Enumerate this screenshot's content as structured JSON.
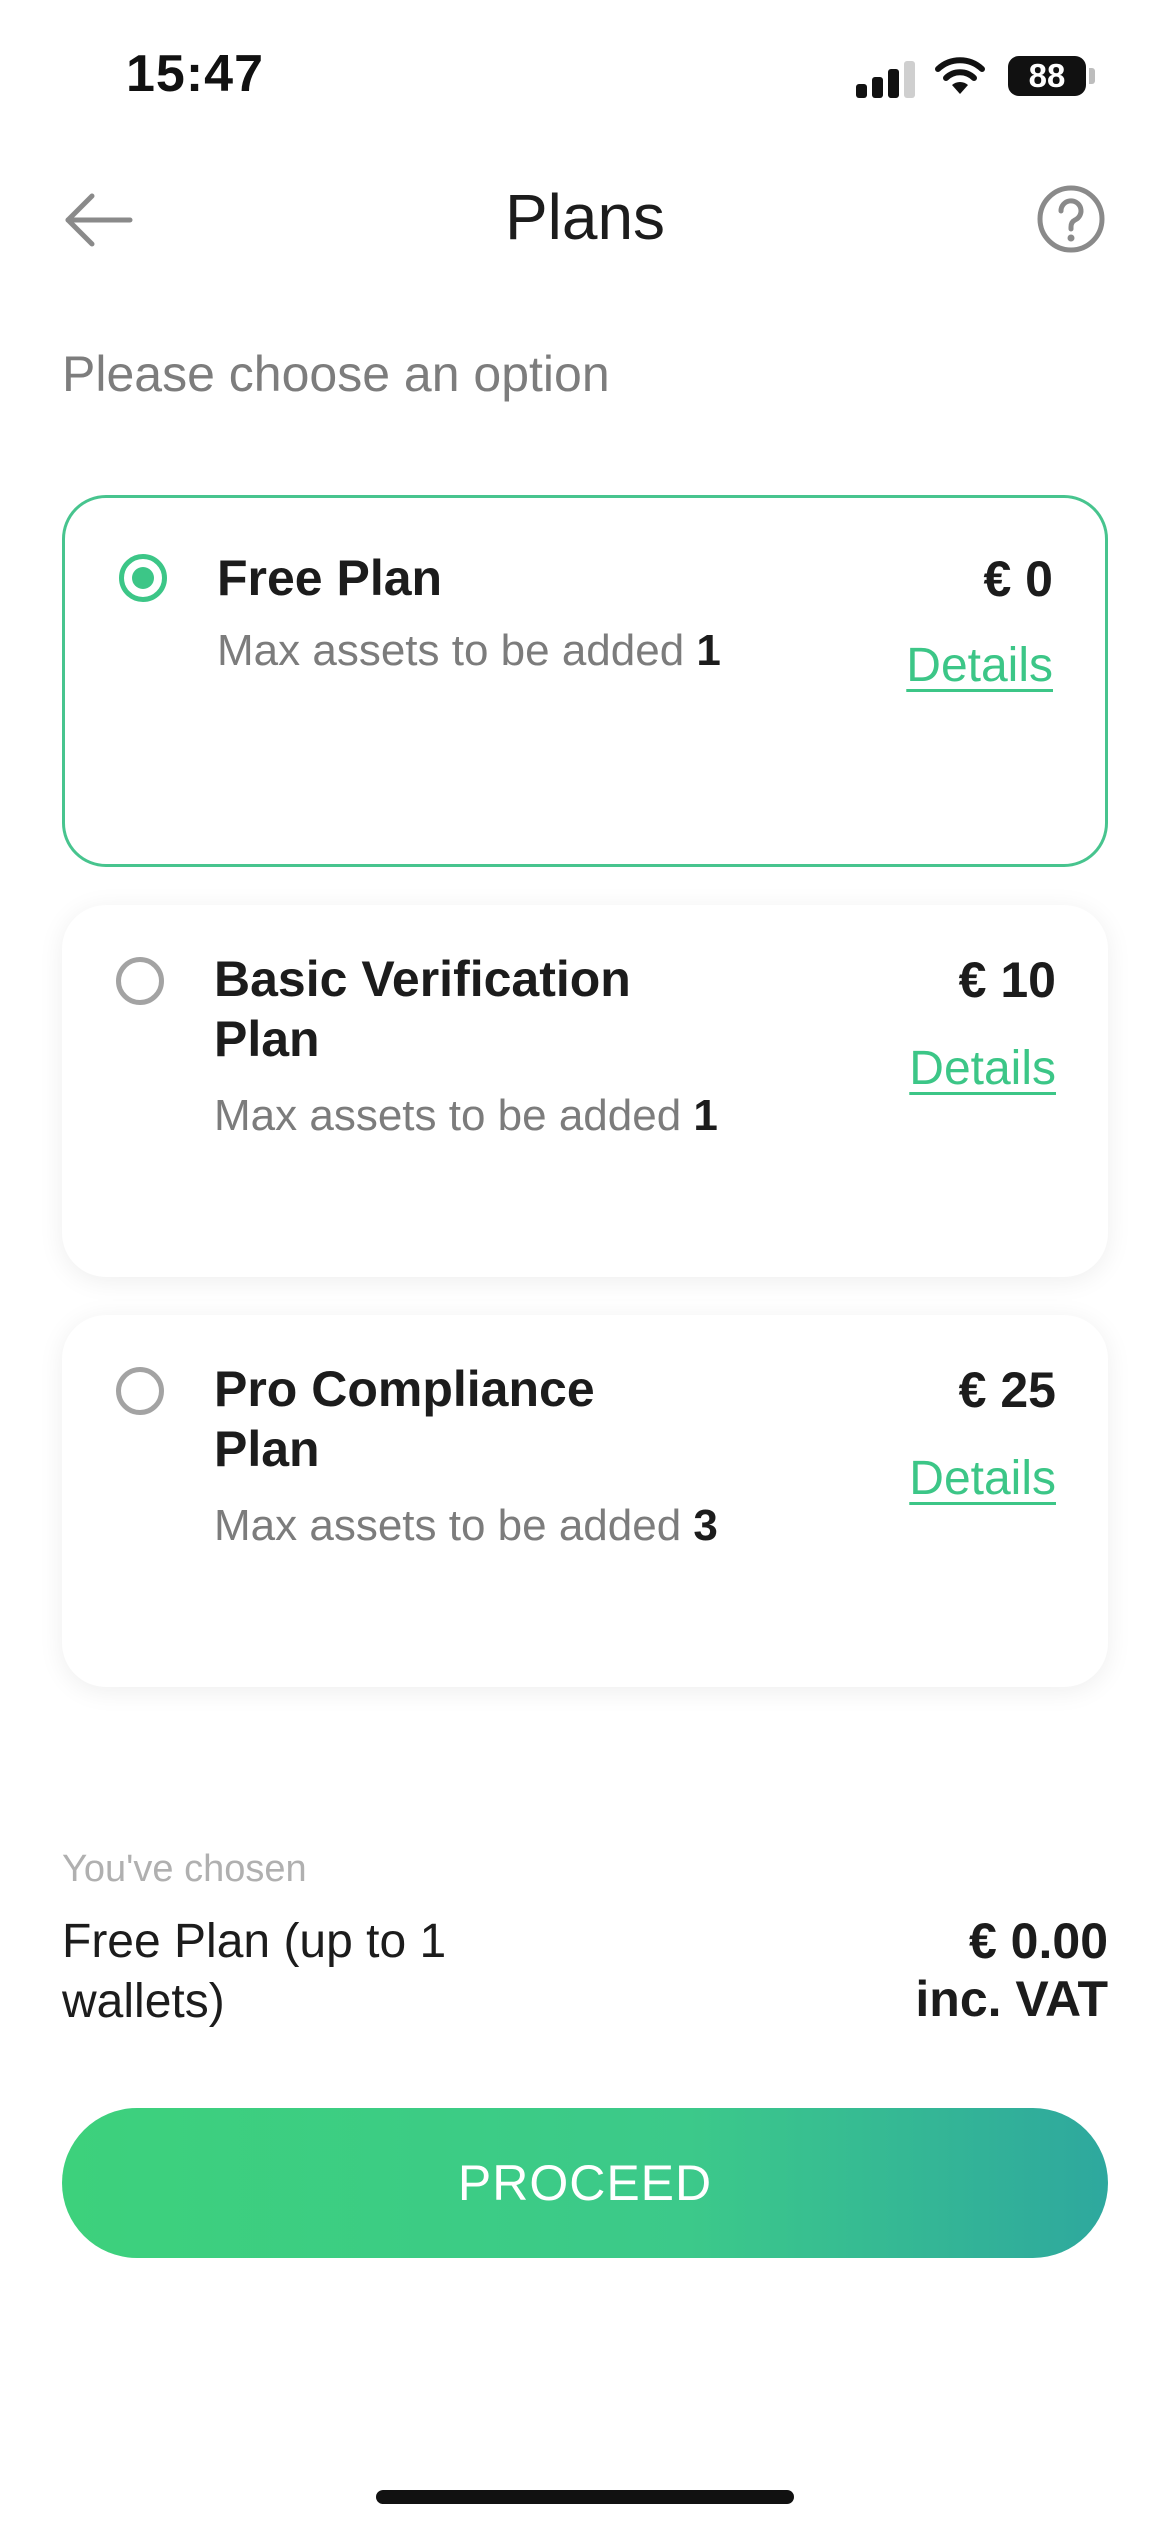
{
  "status_bar": {
    "time": "15:47",
    "battery": "88",
    "icons": [
      "signal-icon",
      "wifi-icon",
      "battery-icon"
    ]
  },
  "header": {
    "title": "Plans",
    "back_icon": "back-arrow-icon",
    "help_icon": "help-icon"
  },
  "subtitle": "Please choose an option",
  "plans": [
    {
      "name": "Free Plan",
      "price": "€ 0",
      "assets_label": "Max assets to be added",
      "assets_count": "1",
      "details_label": "Details",
      "selected": true
    },
    {
      "name": "Basic Verification Plan",
      "price": "€ 10",
      "assets_label": "Max assets to be added",
      "assets_count": "1",
      "details_label": "Details",
      "selected": false
    },
    {
      "name": "Pro Compliance Plan",
      "price": "€ 25",
      "assets_label": "Max assets to be added",
      "assets_count": "3",
      "details_label": "Details",
      "selected": false
    }
  ],
  "summary": {
    "label": "You've chosen",
    "plan": "Free Plan (up to 1 wallets)",
    "price": "€ 0.00",
    "vat": "inc. VAT"
  },
  "proceed_label": "PROCEED",
  "colors": {
    "accent": "#3cc687",
    "gradient_start": "#3dd17c",
    "gradient_end": "#2ea89e",
    "muted_text": "#7d7d7d"
  }
}
